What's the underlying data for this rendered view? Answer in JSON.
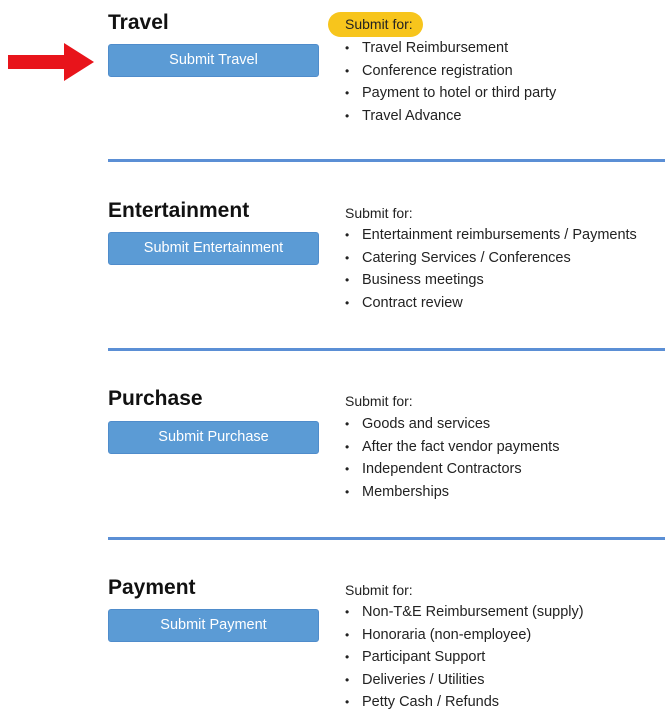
{
  "sections": [
    {
      "title": "Travel",
      "button_label": "Submit Travel",
      "submit_for": "Submit for:",
      "items": [
        "Travel Reimbursement",
        "Conference registration",
        "Payment to hotel or third party",
        "Travel Advance"
      ]
    },
    {
      "title": "Entertainment",
      "button_label": "Submit Entertainment",
      "submit_for": "Submit for:",
      "items": [
        "Entertainment reimbursements / Payments",
        "Catering Services / Conferences",
        "Business meetings",
        "Contract review"
      ]
    },
    {
      "title": "Purchase",
      "button_label": "Submit Purchase",
      "submit_for": "Submit for:",
      "items": [
        "Goods and services",
        "After the fact vendor payments",
        "Independent Contractors",
        "Memberships"
      ]
    },
    {
      "title": "Payment",
      "button_label": "Submit Payment",
      "submit_for": "Submit for:",
      "items": [
        "Non-T&E Reimbursement (supply)",
        "Honoraria (non-employee)",
        "Participant Support",
        "Deliveries / Utilities",
        "Petty Cash / Refunds"
      ]
    }
  ],
  "bullet": "•",
  "colors": {
    "button": "#5b9bd5",
    "divider": "#5b8fd5",
    "highlight": "#f7c51c",
    "arrow": "#e8141b"
  },
  "annotations": {
    "arrow": "right-arrow-icon",
    "highlight": "Submit for: (Travel)"
  }
}
